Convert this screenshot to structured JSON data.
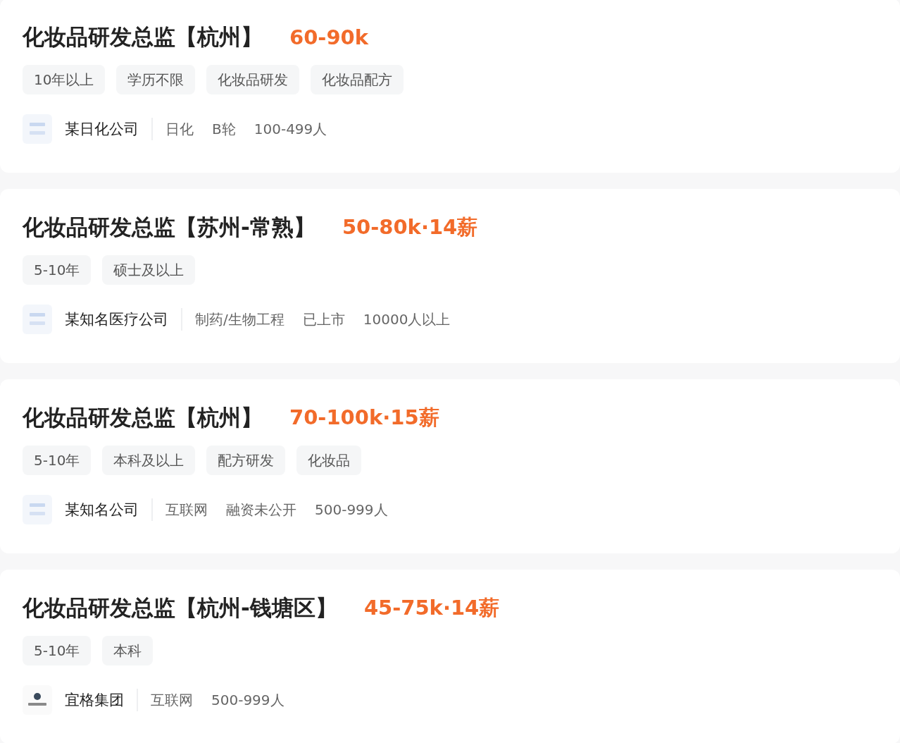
{
  "jobs": [
    {
      "title": "化妆品研发总监【杭州】",
      "salary": "60-90k",
      "tags": [
        "10年以上",
        "学历不限",
        "化妆品研发",
        "化妆品配方"
      ],
      "company": {
        "logo": {
          "kind": "headhunter"
        },
        "name": "某日化公司",
        "info": [
          "日化",
          "B轮",
          "100-499人"
        ]
      }
    },
    {
      "title": "化妆品研发总监【苏州-常熟】",
      "salary": "50-80k·14薪",
      "tags": [
        "5-10年",
        "硕士及以上"
      ],
      "company": {
        "logo": {
          "kind": "headhunter"
        },
        "name": "某知名医疗公司",
        "info": [
          "制药/生物工程",
          "已上市",
          "10000人以上"
        ]
      }
    },
    {
      "title": "化妆品研发总监【杭州】",
      "salary": "70-100k·15薪",
      "tags": [
        "5-10年",
        "本科及以上",
        "配方研发",
        "化妆品"
      ],
      "company": {
        "logo": {
          "kind": "headhunter"
        },
        "name": "某知名公司",
        "info": [
          "互联网",
          "融资未公开",
          "500-999人"
        ]
      }
    },
    {
      "title": "化妆品研发总监【杭州-钱塘区】",
      "salary": "45-75k·14薪",
      "tags": [
        "5-10年",
        "本科"
      ],
      "company": {
        "logo": {
          "kind": "brand"
        },
        "name": "宜格集团",
        "info": [
          "互联网",
          "500-999人"
        ]
      }
    }
  ]
}
